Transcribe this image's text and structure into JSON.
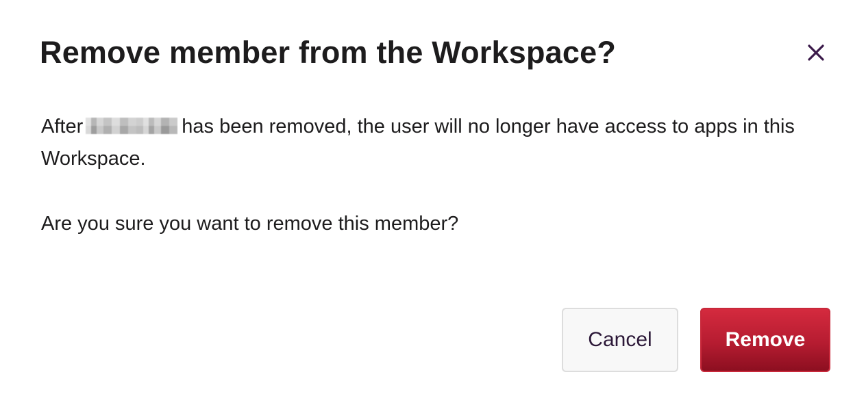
{
  "dialog": {
    "title": "Remove member from the Workspace?",
    "close_icon": "close-icon",
    "body": {
      "text_before_name": "After",
      "text_after_name": "has been removed, the user will no longer have access to apps in this Workspace.",
      "question": "Are you sure you want to remove this member?"
    },
    "buttons": {
      "cancel_label": "Cancel",
      "remove_label": "Remove"
    }
  },
  "colors": {
    "title_text": "#1d1c1d",
    "close_icon": "#3b1a4a",
    "remove_button": "#b61c31",
    "cancel_button_text": "#2c1838"
  }
}
